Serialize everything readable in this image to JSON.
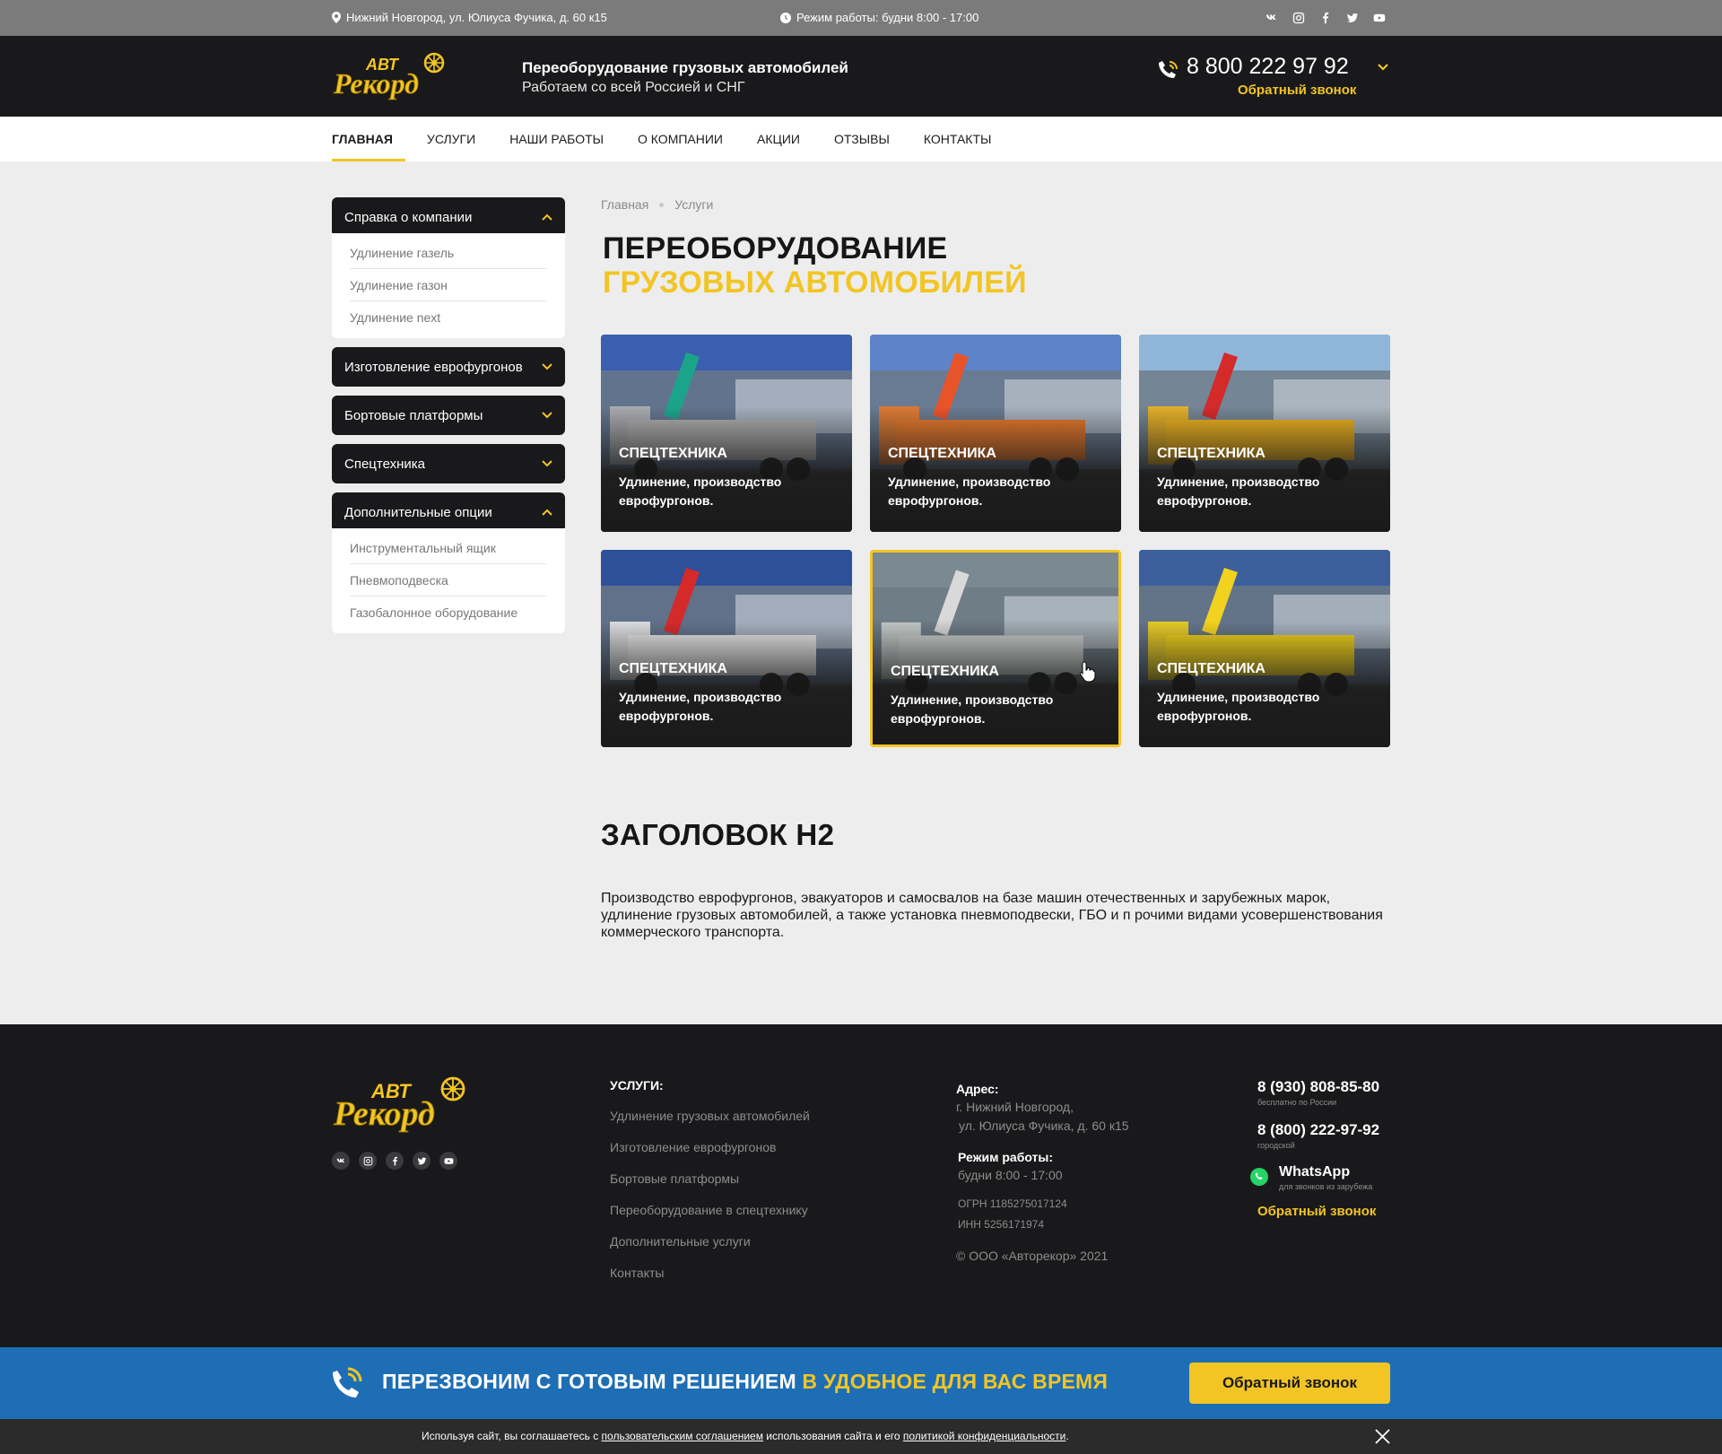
{
  "topbar": {
    "address": "Нижний Новгород, ул. Юлиуса Фучика, д. 60 к15",
    "hours": "Режим работы: будни 8:00 - 17:00",
    "social": [
      "vk-icon",
      "instagram-icon",
      "facebook-icon",
      "twitter-icon",
      "youtube-icon"
    ]
  },
  "header": {
    "logo_top": "АВТО",
    "logo_bottom": "Рекорд",
    "tagline_title": "Переоборудование грузовых автомобилей",
    "tagline_sub": "Работаем со всей Россией и СНГ",
    "phone": "8 800 222 97 92",
    "callback": "Обратный звонок"
  },
  "nav": {
    "items": [
      {
        "label": "ГЛАВНАЯ",
        "active": true
      },
      {
        "label": "УСЛУГИ",
        "active": false
      },
      {
        "label": "НАШИ РАБОТЫ",
        "active": false
      },
      {
        "label": "О КОМПАНИИ",
        "active": false
      },
      {
        "label": "АКЦИИ",
        "active": false
      },
      {
        "label": "ОТЗЫВЫ",
        "active": false
      },
      {
        "label": "КОНТАКТЫ",
        "active": false
      }
    ]
  },
  "sidebar": {
    "groups": [
      {
        "title": "Справка о компании",
        "open": true,
        "items": [
          "Удлинение газель",
          "Удлинение газон",
          "Удлинение next"
        ]
      },
      {
        "title": "Изготовление еврофургонов",
        "open": false,
        "items": []
      },
      {
        "title": "Бортовые платформы",
        "open": false,
        "items": []
      },
      {
        "title": "Спецтехника",
        "open": false,
        "items": []
      },
      {
        "title": "Дополнительные опции",
        "open": true,
        "items": [
          "Инструментальный ящик",
          "Пневмоподвеска",
          "Газобалонное оборудование"
        ]
      }
    ]
  },
  "breadcrumbs": [
    "Главная",
    "Услуги"
  ],
  "page_title": {
    "part1": "ПЕРЕОБОРУДОВАНИЕ ",
    "part2": "ГРУЗОВЫХ АВТОМОБИЛЕЙ"
  },
  "cards": [
    {
      "title": "СПЕЦТЕХНИКА",
      "desc": "Удлинение, производство еврофургонов.",
      "crane": "#1aa58a",
      "body": "#b0b0b0",
      "sky": "#3a5fb0"
    },
    {
      "title": "СПЕЦТЕХНИКА",
      "desc": "Удлинение, производство еврофургонов.",
      "crane": "#e8542a",
      "body": "#e87a2c",
      "sky": "#5d83c9"
    },
    {
      "title": "СПЕЦТЕХНИКА",
      "desc": "Удлинение, производство еврофургонов.",
      "crane": "#d42a2a",
      "body": "#f0b41e",
      "sky": "#8fb6d8"
    },
    {
      "title": "СПЕЦТЕХНИКА",
      "desc": "Удлинение, производство еврофургонов.",
      "crane": "#d42a2a",
      "body": "#e6e6e6",
      "sky": "#2e4f9a"
    },
    {
      "title": "СПЕЦТЕХНИКА",
      "desc": "Удлинение, производство еврофургонов.",
      "crane": "#d9d9d9",
      "body": "#cfd4d2",
      "sky": "#7a8a90"
    },
    {
      "title": "СПЕЦТЕХНИКА",
      "desc": "Удлинение, производство еврофургонов.",
      "crane": "#f2d21e",
      "body": "#f0d21c",
      "sky": "#3d5f9c"
    }
  ],
  "section": {
    "heading": "ЗАГОЛОВОК H2",
    "text": "Производство еврофургонов, эвакуаторов и самосвалов на базе машин отечественных и зарубежных марок, удлинение грузовых автомобилей, а также установка пневмоподвески, ГБО и п рочими видами усовершенствования коммерческого транспорта."
  },
  "footer": {
    "services_title": "УСЛУГИ:",
    "services": [
      "Удлинение грузовых автомобилей",
      "Изготовление еврофургонов",
      "Бортовые платформы",
      "Переоборудование в спецтехнику",
      "Дополнительные услуги",
      "Контакты"
    ],
    "address_label": "Адрес:",
    "address_line1": "г. Нижний Новгород,",
    "address_line2": "ул. Юлиуса Фучика, д. 60 к15",
    "hours_label": "Режим работы:",
    "hours_value": "будни  8:00 - 17:00",
    "ogrn": "ОГРН 1185275017124",
    "inn": "ИНН 5256171974",
    "copyright": "© ООО «Авторекор» 2021",
    "phone1": "8 (930) 808-85-80",
    "phone1_note": "бесплатно по России",
    "phone2": "8 (800) 222-97-92",
    "phone2_note": "городской",
    "whatsapp": "WhatsApp",
    "whatsapp_note": "для звонков из зарубежа",
    "callback": "Обратный звонок"
  },
  "banner": {
    "text_white": "ПЕРЕЗВОНИМ С ГОТОВЫМ РЕШЕНИЕМ ",
    "text_yellow": "В УДОБНОЕ ДЛЯ ВАС ВРЕМЯ",
    "button": "Обратный звонок"
  },
  "cookie": {
    "prefix": "Используя  сайт, вы соглашаетесь с ",
    "link1": "пользовательским соглашением",
    "middle": "  использования сайта и его  ",
    "link2": "политикой конфиденциальности",
    "suffix": "."
  },
  "colors": {
    "accent": "#f2c524",
    "dark": "#19191b",
    "banner": "#1e6eb5"
  }
}
